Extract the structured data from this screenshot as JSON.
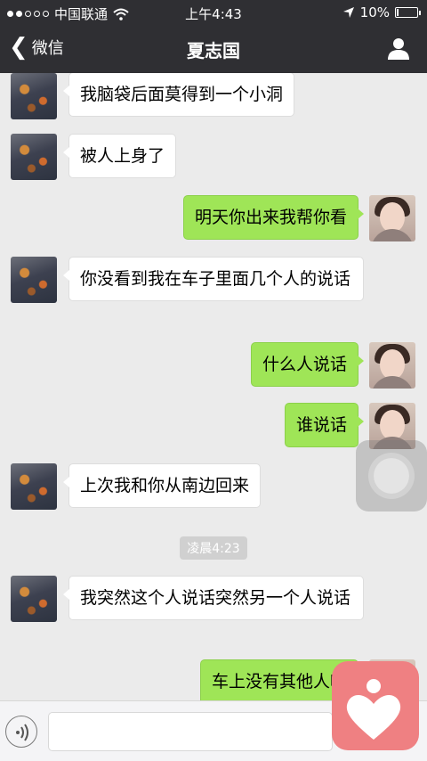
{
  "status_bar": {
    "carrier": "中国联通",
    "time": "上午4:43",
    "battery": "10%",
    "battery_level": 0.1
  },
  "nav": {
    "back_label": "微信",
    "title": "夏志国"
  },
  "messages": [
    {
      "from": "them",
      "text": "我脑袋后面莫得到一个小洞"
    },
    {
      "from": "them",
      "text": "被人上身了"
    },
    {
      "from": "me",
      "text": "明天你出来我帮你看"
    },
    {
      "from": "them",
      "text": "你没看到我在车子里面几个人的说话"
    },
    {
      "from": "me",
      "text": "什么人说话"
    },
    {
      "from": "me",
      "text": "谁说话"
    },
    {
      "from": "them",
      "text": "上次我和你从南边回来"
    },
    {
      "from": "them",
      "text": "我突然这个人说话突然另一个人说话"
    },
    {
      "from": "me",
      "text": "车上没有其他人呀"
    }
  ],
  "timestamp": "凌晨4:23",
  "input": {
    "placeholder": ""
  },
  "icons": {
    "voice": "voice-icon",
    "profile": "profile-icon",
    "back": "chevron-left-icon",
    "wifi": "wifi-icon",
    "location": "location-arrow-icon",
    "heart_app": "heart-app-icon",
    "assistive": "assistive-touch-icon"
  },
  "colors": {
    "nav_bg": "#2f2f33",
    "my_bubble": "#9fe557",
    "their_bubble": "#ffffff",
    "chat_bg": "#ebebeb",
    "heart_app": "#ef8082"
  }
}
